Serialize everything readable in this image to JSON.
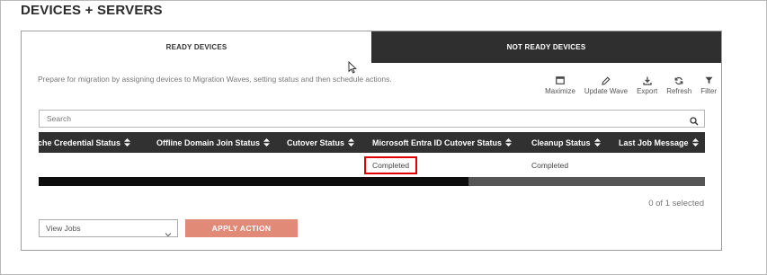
{
  "page": {
    "title": "DEVICES + SERVERS"
  },
  "tabs": [
    {
      "label": "READY DEVICES",
      "active": true
    },
    {
      "label": "NOT READY DEVICES",
      "active": false
    }
  ],
  "description": "Prepare for migration by assigning devices to Migration Waves, setting status and then schedule actions.",
  "toolbar": [
    {
      "label": "Maximize",
      "icon": "maximize-icon"
    },
    {
      "label": "Update Wave",
      "icon": "edit-icon"
    },
    {
      "label": "Export",
      "icon": "download-icon"
    },
    {
      "label": "Refresh",
      "icon": "refresh-icon"
    },
    {
      "label": "Filter",
      "icon": "filter-icon"
    }
  ],
  "search": {
    "placeholder": "Search",
    "value": ""
  },
  "table": {
    "columns": [
      "ache Credential Status",
      "Offline Domain Join Status",
      "Cutover Status",
      "Microsoft Entra ID Cutover Status",
      "Cleanup Status",
      "Last Job Message"
    ],
    "rows": [
      {
        "cells": [
          "",
          "",
          "",
          "Completed",
          "Completed",
          ""
        ]
      }
    ],
    "horizontal_scroll_position": 0
  },
  "selection": {
    "text": "0 of 1 selected"
  },
  "action_select": {
    "value": "View Jobs"
  },
  "apply_button": {
    "label": "APPLY ACTION"
  },
  "colors": {
    "header_dark": "#313131",
    "apply_button": "#e18a78",
    "highlight_border": "#e00000"
  }
}
